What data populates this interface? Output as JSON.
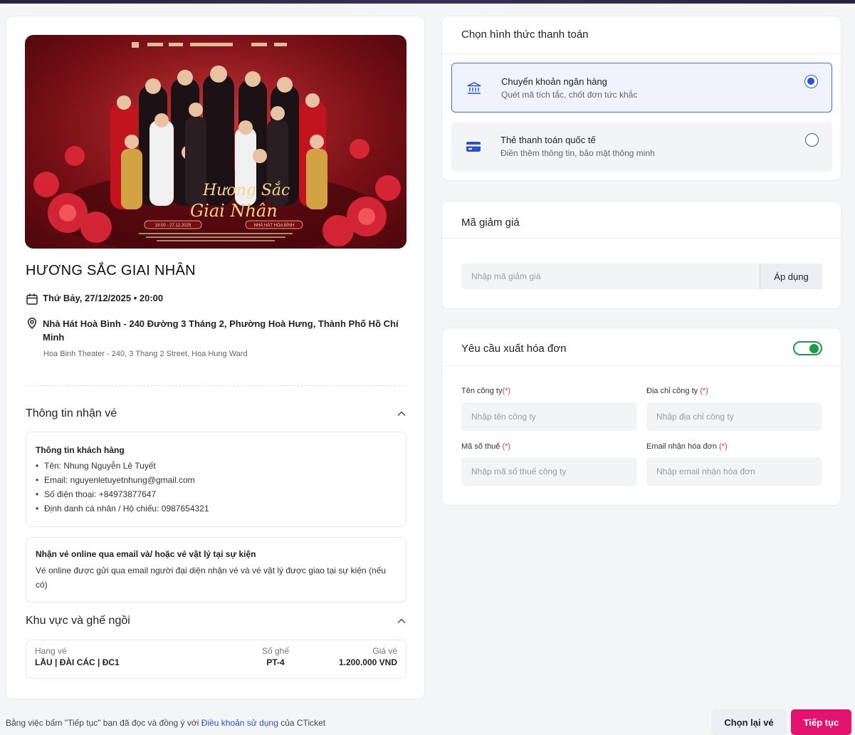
{
  "event": {
    "title": "HƯƠNG SẮC GIAI NHÂN",
    "date": "Thứ Bảy, 27/12/2025 • 20:00",
    "address": "Nhà Hát Hoà Bình - 240 Đường 3 Tháng 2, Phường Hoà Hưng, Thành Phố Hồ Chí Minh",
    "address_en": "Hoa Binh Theater - 240, 3 Thang 2 Street, Hoa Hung Ward",
    "poster": {
      "script_title_line1": "Hương Sắc",
      "script_title_line2": "Giai Nhân",
      "date_badge": "19:00 - 27.12.2025",
      "venue_badge": "NHÀ HÁT HÒA BÌNH"
    }
  },
  "ticket_info": {
    "section_title": "Thông tin nhận vé",
    "customer": {
      "heading": "Thông tin khách hàng",
      "name": "Tên: Nhung Nguyễn Lê Tuyết",
      "email": "Email: nguyenletuyetnhung@gmail.com",
      "phone": "Số điện thoại: +84973877647",
      "id": "Định danh cá nhân / Hộ chiếu: 0987654321"
    },
    "delivery": {
      "heading": "Nhận vé online qua email và/ hoặc vé vật lý tại sự kiện",
      "text": "Vé online được gửi qua email người đại diện nhận vé và vé vật lý được giao tại sự kiện (nếu có)"
    }
  },
  "seats": {
    "section_title": "Khu vực và ghế ngồi",
    "headers": {
      "type": "Hạng vé",
      "seat": "Số ghế",
      "price": "Giá vé"
    },
    "row": {
      "type": "LẦU | ĐÀI CÁC | ĐC1",
      "seat": "PT-4",
      "price": "1.200.000 VND"
    }
  },
  "payment": {
    "title": "Chọn hình thức thanh toán",
    "options": [
      {
        "name": "Chuyển khoản ngân hàng",
        "desc": "Quét mã tích tắc, chốt đơn tức khắc",
        "selected": true,
        "icon": "bank-icon"
      },
      {
        "name": "Thẻ thanh toán quốc tế",
        "desc": "Điền thêm thông tin, bảo mật thông minh",
        "selected": false,
        "icon": "credit-card-icon"
      }
    ]
  },
  "discount": {
    "title": "Mã giảm giá",
    "placeholder": "Nhập mã giảm giá",
    "apply_label": "Áp dụng"
  },
  "invoice": {
    "title": "Yêu cầu xuất hóa đơn",
    "toggle_on": true,
    "company_name_label": "Tên công ty",
    "company_name_placeholder": "Nhập tên công ty",
    "company_address_label": "Địa chỉ công ty ",
    "company_address_placeholder": "Nhập địa chỉ công ty",
    "tax_label": "Mã số thuế ",
    "tax_placeholder": "Nhập mã số thuế công ty",
    "email_label": "Email nhận hóa đơn ",
    "email_placeholder": "Nhập email nhận hóa đơn",
    "required_mark": "(*)"
  },
  "footer": {
    "note_prefix": "Bằng việc bấm \"Tiếp tục\" bạn đã đọc và đồng ý với ",
    "terms_link": "Điều khoản sử dụng",
    "note_suffix": " của CTicket",
    "back_label": "Chọn lại vé",
    "next_label": "Tiếp tục"
  },
  "colors": {
    "accent_blue": "#2a4fcf",
    "brand_pink": "#e3146f",
    "toggle_green": "#1f9a4a"
  }
}
